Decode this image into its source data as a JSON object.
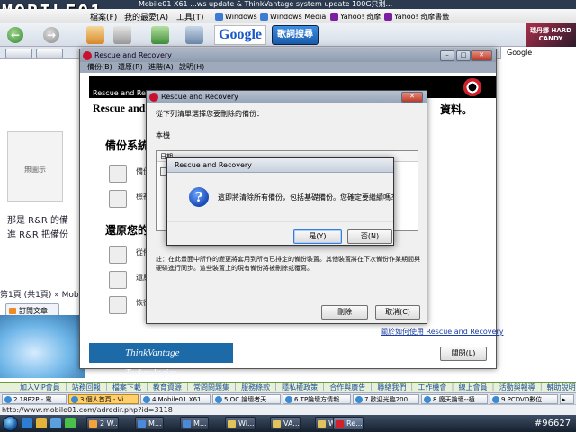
{
  "browser": {
    "title": "Mobile01 X61 ...ws update & ThinkVantage system update 100G只剩...",
    "logo_text": "MOBILE01",
    "menu": [
      "檔案(F)",
      "我的最愛(A)",
      "工具(T)"
    ],
    "bookmarks": [
      "Windows",
      "Windows Media",
      "Yahoo! 奇摩",
      "Yahoo! 奇摩書籤"
    ],
    "google_label": "Google",
    "search_button": "歌詞搜尋",
    "brand_badge": "瑞丹娜 HARD CANDY",
    "side_search_placeholder": "Google"
  },
  "page": {
    "image_placeholder": "無圖示",
    "text_line1": "那是 R&R 的備",
    "text_line2": "進 R&R 把備份",
    "pager": "第1頁 (共1頁) » Mobile0",
    "subscribe": "訂閱文章",
    "footer_links": "加入VIP會員 ｜ 站務回報 ｜ 檔案下載 ｜ 教育資源 ｜ 常問問題集 ｜ 服務條款 ｜ 隱私權政策 ｜ 合作與廣告 ｜ 聯絡我們 ｜ 工作機會 ｜ 線上會員 ｜ 活動與報導 ｜ 輔助說明"
  },
  "tabs": [
    {
      "label": "2.18P2P - 電..."
    },
    {
      "label": "3.個人首頁 - Vi..."
    },
    {
      "label": "4.Mobile01 X61..."
    },
    {
      "label": "5.OC 論壇者天..."
    },
    {
      "label": "6.TP論壇方情報..."
    },
    {
      "label": "7.歡迎光臨200..."
    },
    {
      "label": "8.魔天論壇--極..."
    },
    {
      "label": "9.PCDVD數位..."
    }
  ],
  "active_tab_index": 1,
  "status_url": "http://www.mobile01.com/adredir.php?id=3118",
  "taskbar": {
    "tasks": [
      {
        "label": "2 W...",
        "color": "#f2a43a"
      },
      {
        "label": "M...",
        "color": "#4a8ad8"
      },
      {
        "label": "M...",
        "color": "#4a8ad8"
      },
      {
        "label": "Wi...",
        "color": "#e0c35a"
      },
      {
        "label": "VA...",
        "color": "#e0c35a"
      },
      {
        "label": "Wi...",
        "color": "#e0c35a"
      },
      {
        "label": "Re...",
        "color": "#d4202c"
      }
    ],
    "clock": "#96627"
  },
  "main_window": {
    "title": "Rescue and Recovery",
    "menu": [
      "備份(B)",
      "還原(R)",
      "進階(A)",
      "說明(H)"
    ],
    "banner": "Rescue and Recovery",
    "heading_left": "Rescue and R",
    "heading_right": "資料。",
    "section_backup": "備份系統",
    "backup_item1": "備份",
    "backup_item2": "檢視",
    "section_restore": "還原您的",
    "restore_item1": "從備",
    "restore_item2": "還原",
    "restore_item3": "恢復",
    "link_bottom": "關於如何使用 Rescue and Recovery",
    "thinkvantage": "ThinkVantage Technologies",
    "close_button": "關閉(L)"
  },
  "delete_dialog": {
    "title": "Rescue and Recovery",
    "prompt": "從下列清單選擇您要刪除的備份：",
    "location_label": "本機",
    "list_header": "日期",
    "note": "註：在此畫面中所作的變更將套用到所有已排定的備份裝置。其他裝置將在下次備份作業期間與硬碟進行同步。這些裝置上的現有備份將被刪除或覆寫。",
    "delete_button": "刪除",
    "cancel_button": "取消(C)"
  },
  "confirm_dialog": {
    "title": "Rescue and Recovery",
    "message": "這即將清除所有備份，包括基礎備份。您確定要繼續嗎？",
    "yes_button": "是(Y)",
    "no_button": "否(N)"
  }
}
